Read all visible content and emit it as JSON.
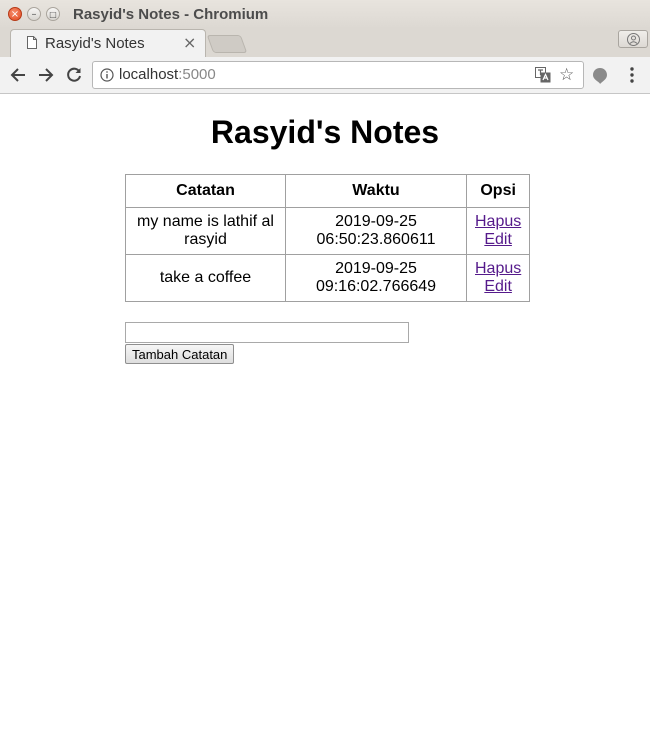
{
  "window": {
    "title": "Rasyid's Notes - Chromium"
  },
  "tab": {
    "label": "Rasyid's Notes"
  },
  "omnibox": {
    "host": "localhost",
    "port": ":5000"
  },
  "page": {
    "heading": "Rasyid's Notes",
    "table": {
      "headers": [
        "Catatan",
        "Waktu",
        "Opsi"
      ],
      "rows": [
        {
          "catatan": "my name is lathif al rasyid",
          "waktu": "2019-09-25 06:50:23.860611",
          "hapus": "Hapus",
          "edit": "Edit"
        },
        {
          "catatan": "take a coffee",
          "waktu": "2019-09-25 09:16:02.766649",
          "hapus": "Hapus",
          "edit": "Edit"
        }
      ]
    },
    "form": {
      "input_value": "",
      "submit_label": "Tambah Catatan"
    }
  },
  "colors": {
    "visited_link": "#551a8b",
    "close_button": "#e2491f"
  },
  "icons": [
    "close-icon",
    "minimize-icon",
    "maximize-icon",
    "page-icon",
    "tab-close-icon",
    "profile-icon",
    "back-arrow-icon",
    "forward-arrow-icon",
    "reload-icon",
    "info-icon",
    "translate-icon",
    "star-icon",
    "extension-icon",
    "menu-icon"
  ]
}
